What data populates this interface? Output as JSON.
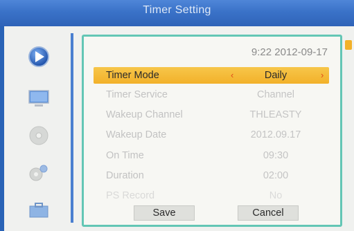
{
  "window": {
    "title": "Timer Setting"
  },
  "clock": "9:22 2012-09-17",
  "rows": [
    {
      "label": "Timer Mode",
      "value": "Daily"
    },
    {
      "label": "Timer Service",
      "value": "Channel"
    },
    {
      "label": "Wakeup Channel",
      "value": "THLEASTY"
    },
    {
      "label": "Wakeup Date",
      "value": "2012.09.17"
    },
    {
      "label": "On Time",
      "value": "09:30"
    },
    {
      "label": "Duration",
      "value": "02:00"
    },
    {
      "label": "PS Record",
      "value": "No"
    }
  ],
  "arrows": {
    "left": "‹",
    "right": "›"
  },
  "buttons": {
    "save": "Save",
    "cancel": "Cancel"
  },
  "sidebar": {
    "icons": [
      "play-icon",
      "monitor-icon",
      "disc-icon",
      "settings-icon",
      "briefcase-icon"
    ]
  },
  "colors": {
    "accent": "#f2b12a",
    "frame": "#63c6b5",
    "titlebar": "#3a72c8"
  }
}
